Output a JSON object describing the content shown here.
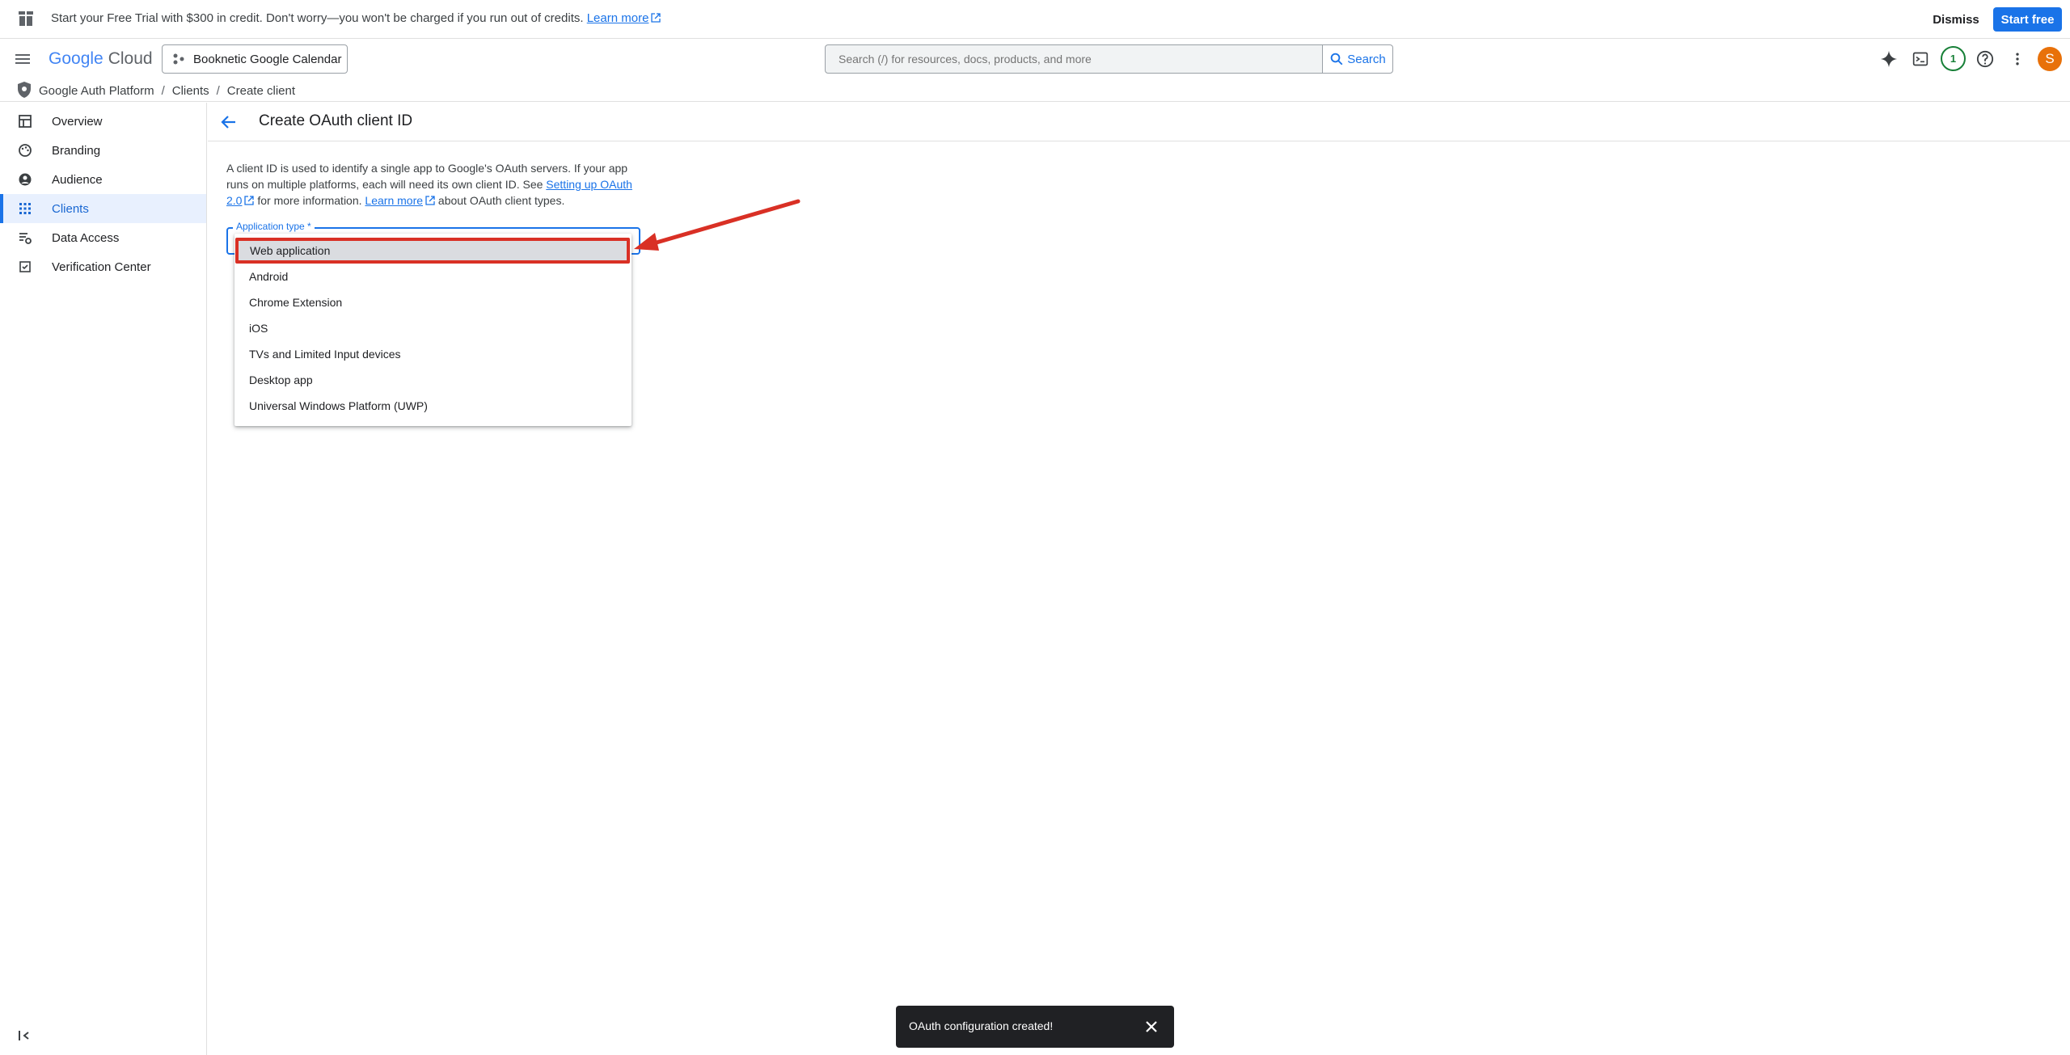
{
  "banner": {
    "text": "Start your Free Trial with $300 in credit. Don't worry—you won't be charged if you run out of credits.",
    "link": "Learn more",
    "dismiss": "Dismiss",
    "start_free": "Start free"
  },
  "header": {
    "logo_google": "Google",
    "logo_cloud": "Cloud",
    "project": "Booknetic Google Calendar",
    "search_placeholder": "Search (/) for resources, docs, products, and more",
    "search_button": "Search",
    "notifications": "1",
    "avatar": "S"
  },
  "breadcrumb": {
    "items": [
      "Google Auth Platform",
      "Clients",
      "Create client"
    ]
  },
  "sidebar": {
    "items": [
      {
        "label": "Overview",
        "icon": "dashboard-icon"
      },
      {
        "label": "Branding",
        "icon": "palette-icon"
      },
      {
        "label": "Audience",
        "icon": "person-icon"
      },
      {
        "label": "Clients",
        "icon": "grid-icon"
      },
      {
        "label": "Data Access",
        "icon": "data-access-icon"
      },
      {
        "label": "Verification Center",
        "icon": "checklist-icon"
      }
    ],
    "active": "Clients"
  },
  "main": {
    "title": "Create OAuth client ID",
    "desc_1": "A client ID is used to identify a single app to Google's OAuth servers. If your app runs on multiple platforms, each will need its own client ID. See",
    "desc_link1": "Setting up OAuth 2.0",
    "desc_2": "for more information.",
    "desc_link2": "Learn more",
    "desc_3": "about OAuth client types.",
    "field_label": "Application type *",
    "options": [
      "Web application",
      "Android",
      "Chrome Extension",
      "iOS",
      "TVs and Limited Input devices",
      "Desktop app",
      "Universal Windows Platform (UWP)"
    ]
  },
  "toast": {
    "text": "OAuth configuration created!"
  },
  "colors": {
    "accent": "#1a73e8",
    "highlight": "#d93025"
  }
}
